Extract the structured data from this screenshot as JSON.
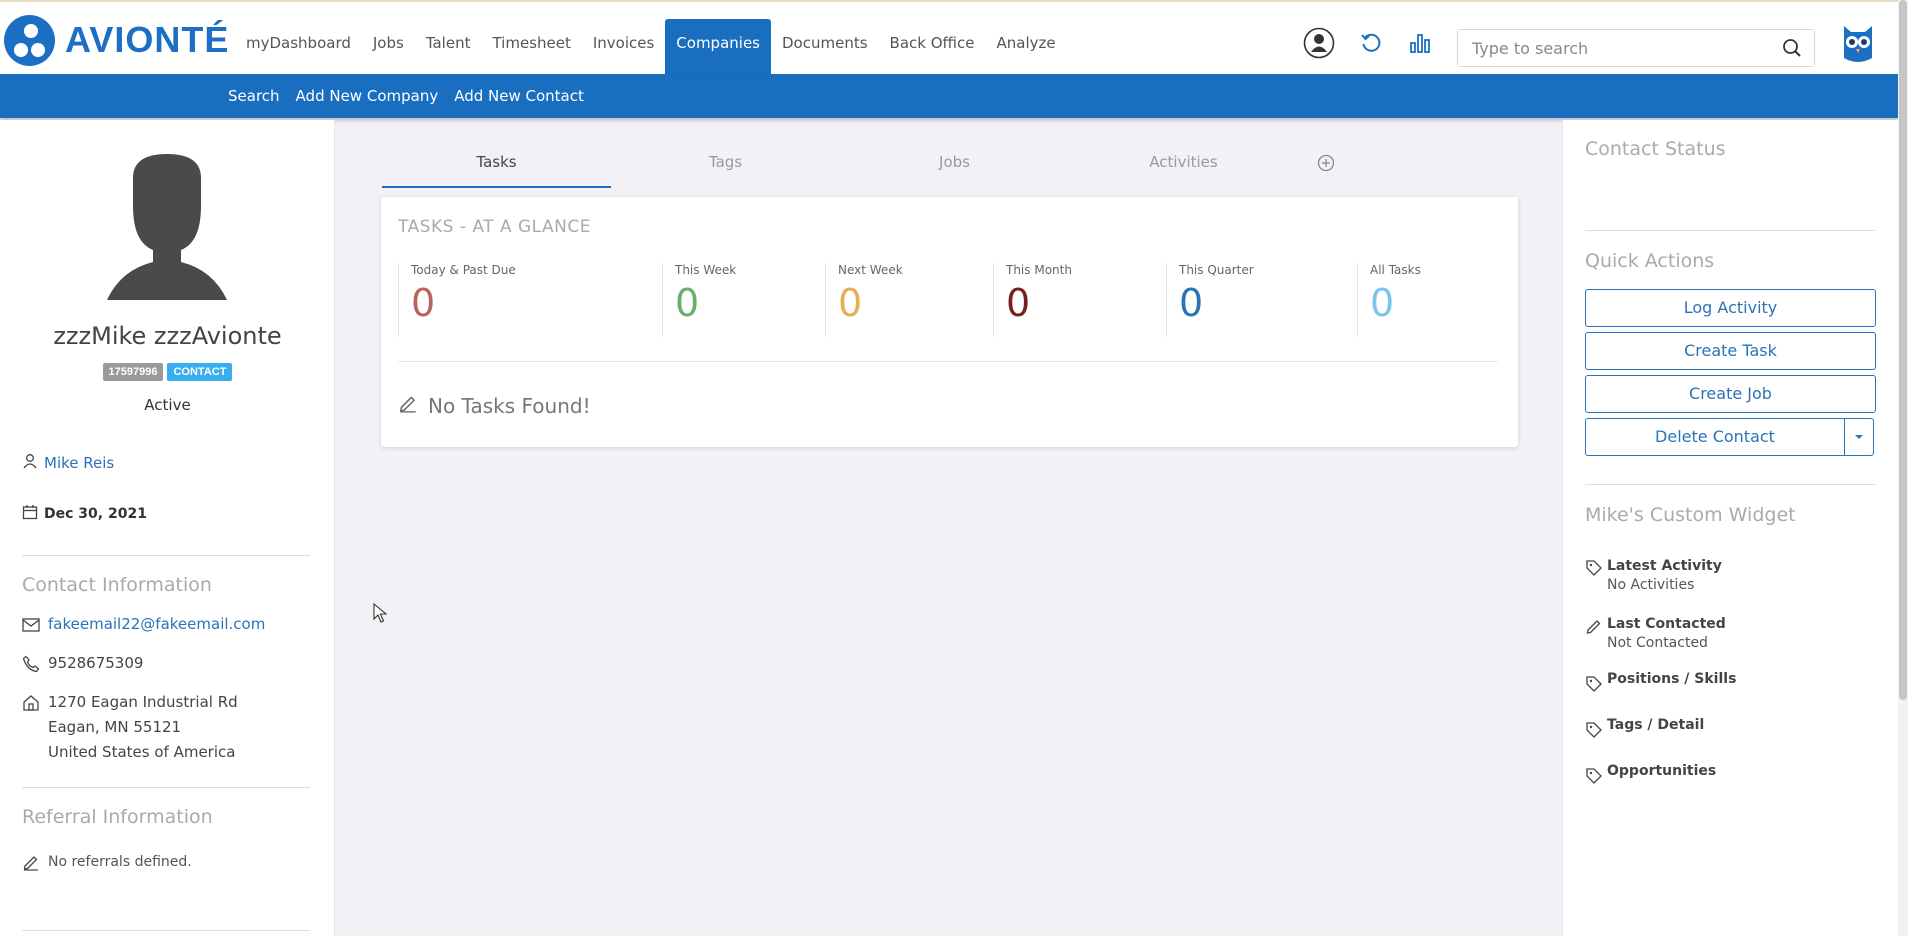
{
  "brand": {
    "name": "AVIONTÉ"
  },
  "nav": {
    "items": [
      "myDashboard",
      "Jobs",
      "Talent",
      "Timesheet",
      "Invoices",
      "Companies",
      "Documents",
      "Back Office",
      "Analyze"
    ],
    "active": "Companies"
  },
  "header": {
    "search_placeholder": "Type to search",
    "icons": [
      "user-circle-icon",
      "refresh-icon",
      "bar-chart-icon",
      "search-icon",
      "owl-icon"
    ]
  },
  "subnav": {
    "items": [
      "Search",
      "Add New Company",
      "Add New Contact"
    ]
  },
  "contact": {
    "name": "zzzMike zzzAvionte",
    "id_badge": "17597996",
    "type_badge": "CONTACT",
    "status": "Active",
    "owner": "Mike Reis",
    "date": "Dec 30, 2021"
  },
  "contact_info": {
    "title": "Contact Information",
    "email": "fakeemail22@fakeemail.com",
    "phone": "9528675309",
    "address": [
      "1270 Eagan Industrial Rd",
      "Eagan, MN 55121",
      "United States of America"
    ]
  },
  "referral": {
    "title": "Referral Information",
    "empty": "No referrals defined."
  },
  "tabs": [
    "Tasks",
    "Tags",
    "Jobs",
    "Activities"
  ],
  "tasks": {
    "title": "TASKS - AT A GLANCE",
    "stats": [
      {
        "label": "Today & Past Due",
        "value": "0",
        "color": "#b5645f"
      },
      {
        "label": "This Week",
        "value": "0",
        "color": "#6aae6a"
      },
      {
        "label": "Next Week",
        "value": "0",
        "color": "#e8ac58"
      },
      {
        "label": "This Month",
        "value": "0",
        "color": "#7a1f1f"
      },
      {
        "label": "This Quarter",
        "value": "0",
        "color": "#2a73b7"
      },
      {
        "label": "All Tasks",
        "value": "0",
        "color": "#7cc4ec"
      }
    ],
    "empty": "No Tasks Found!"
  },
  "right": {
    "contact_status_title": "Contact Status",
    "quick_actions_title": "Quick Actions",
    "buttons": {
      "log_activity": "Log Activity",
      "create_task": "Create Task",
      "create_job": "Create Job",
      "delete_contact": "Delete Contact"
    },
    "widget": {
      "title": "Mike's Custom Widget",
      "rows": [
        {
          "label": "Latest Activity",
          "value": "No Activities"
        },
        {
          "label": "Last Contacted",
          "value": "Not Contacted"
        },
        {
          "label": "Positions / Skills",
          "value": ""
        },
        {
          "label": "Tags / Detail",
          "value": ""
        },
        {
          "label": "Opportunities",
          "value": ""
        }
      ]
    }
  }
}
